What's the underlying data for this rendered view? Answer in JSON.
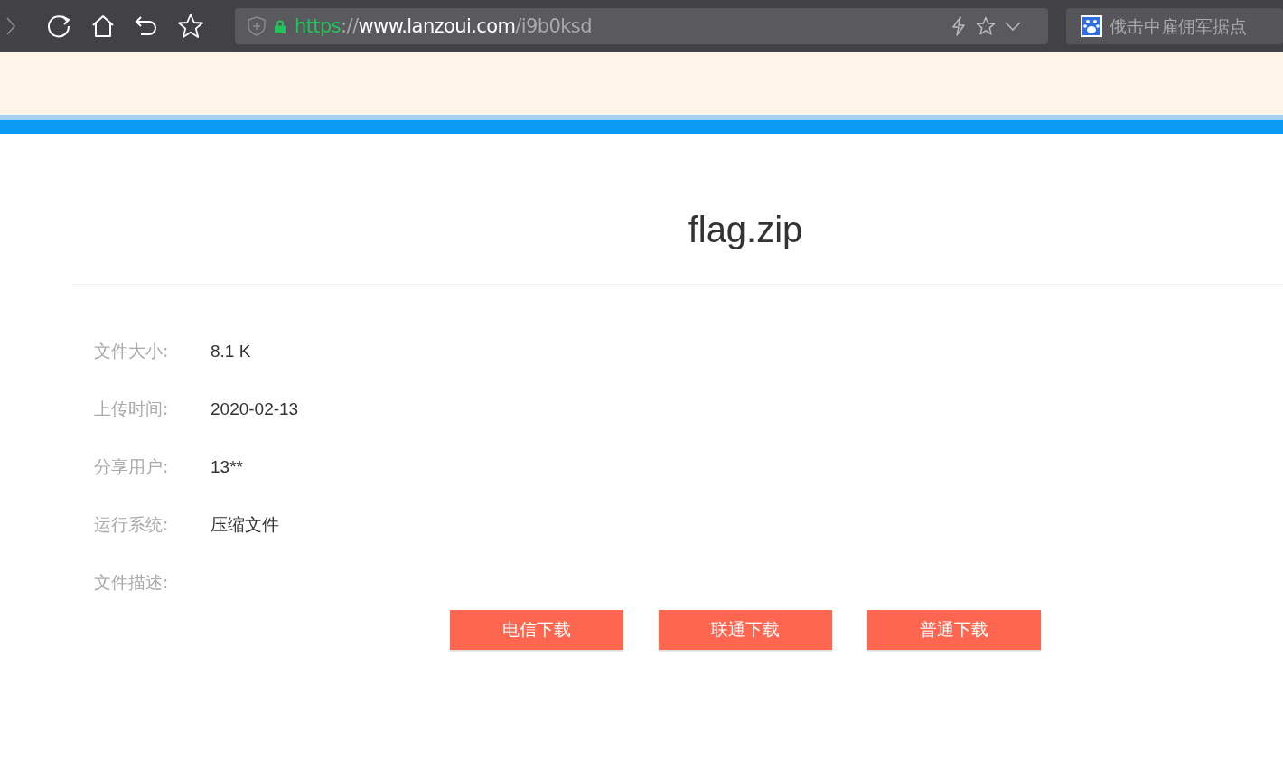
{
  "browser": {
    "url_parts": [
      {
        "kind": "scheme",
        "text": "https"
      },
      {
        "kind": "separator",
        "text": "://"
      },
      {
        "kind": "host",
        "text": "www.lanzoui.com"
      },
      {
        "kind": "path",
        "text": "/i9b0ksd"
      }
    ],
    "search": {
      "placeholder": "俄击中雇佣军据点"
    }
  },
  "file": {
    "title": "flag.zip",
    "details": [
      {
        "label": "文件大小:",
        "value": "8.1 K"
      },
      {
        "label": "上传时间:",
        "value": "2020-02-13"
      },
      {
        "label": "分享用户:",
        "value": "13**"
      },
      {
        "label": "运行系统:",
        "value": "压缩文件"
      },
      {
        "label": "文件描述:"
      }
    ],
    "buttons": [
      "电信下载",
      "联通下载",
      "普通下载"
    ]
  }
}
